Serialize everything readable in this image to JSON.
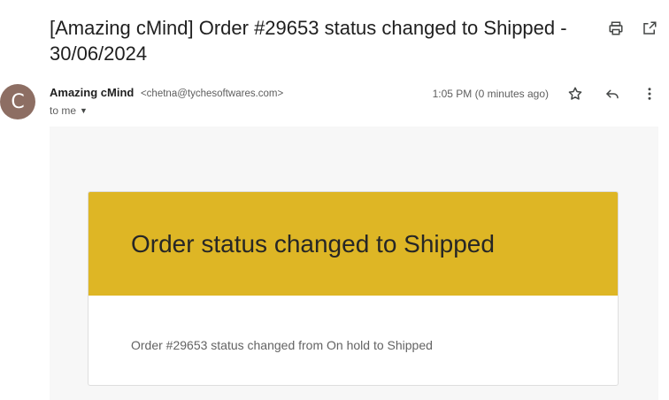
{
  "email": {
    "subject": "[Amazing cMind] Order #29653 status changed to Shipped - 30/06/2024",
    "sender": {
      "avatar_letter": "C",
      "avatar_color": "#8d6e63",
      "name": "Amazing cMind",
      "email": "<chetna@tychesoftwares.com>"
    },
    "recipient_label": "to me",
    "time": "1:05 PM (0 minutes ago)"
  },
  "toolbar": {
    "icons": [
      "print-icon",
      "open-in-new-window-icon",
      "star-icon",
      "reply-icon",
      "more-vert-icon"
    ]
  },
  "body": {
    "header_color": "#deb625",
    "heading": "Order status changed to Shipped",
    "message": "Order #29653 status changed from On hold to Shipped"
  }
}
